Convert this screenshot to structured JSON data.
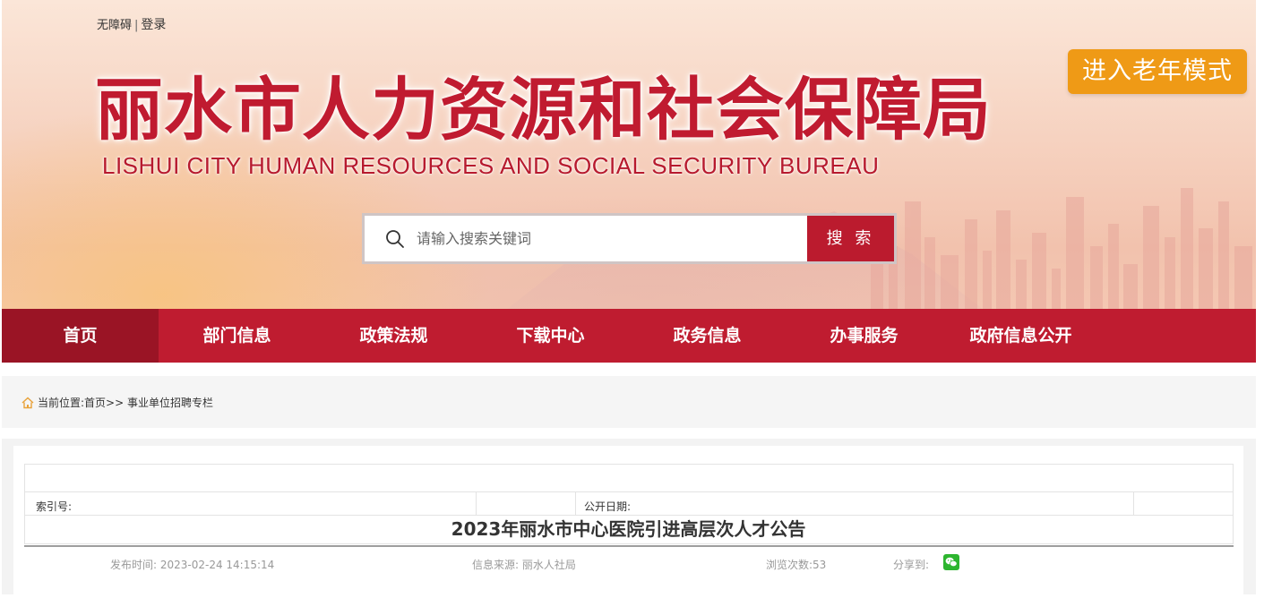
{
  "header": {
    "accessibility_link": "无障碍",
    "separator": "|",
    "login_link": "登录",
    "elder_mode_button": "进入老年模式",
    "site_title": "丽水市人力资源和社会保障局",
    "site_subtitle": "LISHUI CITY HUMAN RESOURCES AND SOCIAL SECURITY BUREAU"
  },
  "search": {
    "placeholder": "请输入搜索关键词",
    "value": "",
    "button_label": "搜 索"
  },
  "nav": {
    "items": [
      {
        "label": "首页",
        "active": true
      },
      {
        "label": "部门信息"
      },
      {
        "label": "政策法规"
      },
      {
        "label": "下载中心"
      },
      {
        "label": "政务信息"
      },
      {
        "label": "办事服务"
      },
      {
        "label": "政府信息公开"
      }
    ]
  },
  "breadcrumb": {
    "label": "当前位置:",
    "path": "首页>> 事业单位招聘专栏"
  },
  "article": {
    "index_label": "索引号:",
    "index_value": "",
    "publish_date_label": "公开日期:",
    "publish_date_value": "",
    "title": "2023年丽水市中心医院引进高层次人才公告",
    "published_time": "发布时间: 2023-02-24 14:15:14",
    "source": "信息来源: 丽水人社局",
    "views": "浏览次数:53",
    "share_label": "分享到:"
  },
  "colors": {
    "brand_red": "#bf1c30",
    "nav_active": "#9a1425",
    "elder_button": "#ef9a16",
    "wechat_green": "#2db52f"
  },
  "icons": [
    "search-icon",
    "home-icon",
    "wechat-icon"
  ]
}
